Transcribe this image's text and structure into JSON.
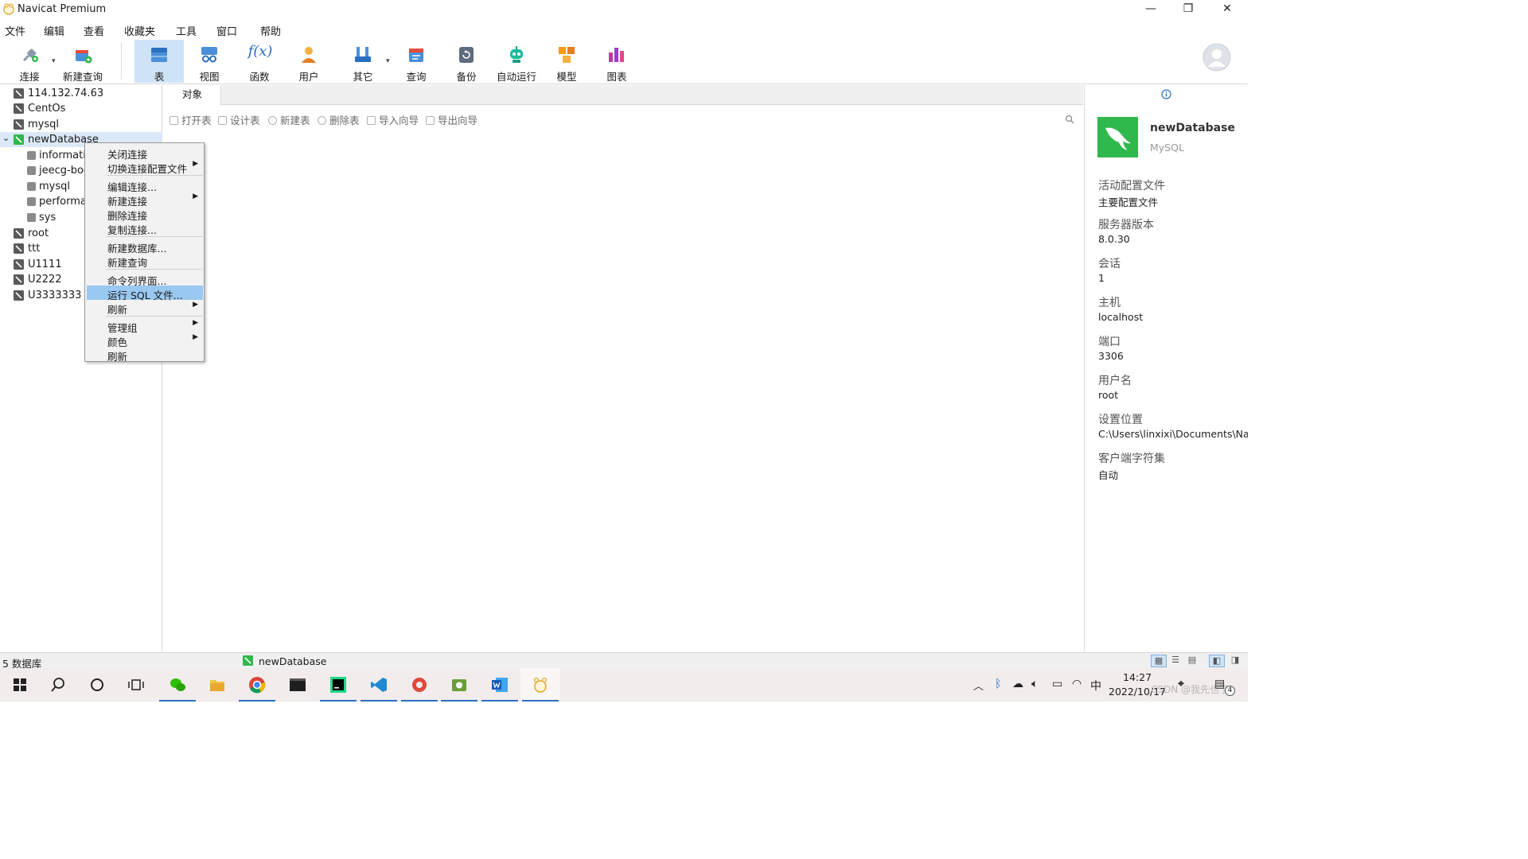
{
  "window": {
    "title": "Navicat Premium",
    "minimize": "—",
    "restore": "❐",
    "close": "✕"
  },
  "menu": [
    "文件",
    "编辑",
    "查看",
    "收藏夹",
    "工具",
    "窗口",
    "帮助"
  ],
  "toolbar": {
    "items": [
      {
        "label": "连接",
        "icon": "plug-icon"
      },
      {
        "label": "新建查询",
        "icon": "new-query-icon"
      },
      {
        "label": "表",
        "icon": "table-icon",
        "active": true
      },
      {
        "label": "视图",
        "icon": "view-icon"
      },
      {
        "label": "函数",
        "icon": "function-icon",
        "glyph": "f(x)"
      },
      {
        "label": "用户",
        "icon": "user-icon"
      },
      {
        "label": "其它",
        "icon": "tools-icon"
      },
      {
        "label": "查询",
        "icon": "query-icon"
      },
      {
        "label": "备份",
        "icon": "backup-icon"
      },
      {
        "label": "自动运行",
        "icon": "robot-icon"
      },
      {
        "label": "模型",
        "icon": "model-icon"
      },
      {
        "label": "图表",
        "icon": "chart-icon"
      }
    ]
  },
  "tree": {
    "connections": [
      {
        "name": "114.132.74.63"
      },
      {
        "name": "CentOs"
      },
      {
        "name": "mysql"
      },
      {
        "name": "newDatabase",
        "expanded": true,
        "selected": true
      },
      {
        "name": "root"
      },
      {
        "name": "ttt"
      },
      {
        "name": "U1111"
      },
      {
        "name": "U2222"
      },
      {
        "name": "U3333333"
      }
    ],
    "databases": [
      "informatio",
      "jeecg-boo",
      "mysql",
      "performa",
      "sys"
    ]
  },
  "context_menu": {
    "groups": [
      [
        {
          "label": "关闭连接"
        },
        {
          "label": "切换连接配置文件",
          "submenu": true
        }
      ],
      [
        {
          "label": "编辑连接..."
        },
        {
          "label": "新建连接",
          "submenu": true
        },
        {
          "label": "删除连接"
        },
        {
          "label": "复制连接..."
        }
      ],
      [
        {
          "label": "新建数据库..."
        },
        {
          "label": "新建查询"
        }
      ],
      [
        {
          "label": "命令列界面..."
        },
        {
          "label": "运行 SQL 文件...",
          "highlighted": true
        },
        {
          "label": "刷新",
          "submenu": true
        }
      ],
      [
        {
          "label": "管理组",
          "submenu": true
        },
        {
          "label": "颜色",
          "submenu": true
        },
        {
          "label": "刷新"
        }
      ]
    ]
  },
  "center": {
    "tab": "对象",
    "object_toolbar": [
      "打开表",
      "设计表",
      "新建表",
      "删除表",
      "导入向导",
      "导出向导"
    ]
  },
  "info_panel": {
    "name": "newDatabase",
    "type": "MySQL",
    "fields": [
      {
        "key": "活动配置文件",
        "value": "主要配置文件"
      },
      {
        "key": "服务器版本",
        "value": "8.0.30"
      },
      {
        "key": "会话",
        "value": "1"
      },
      {
        "key": "主机",
        "value": "localhost"
      },
      {
        "key": "端口",
        "value": "3306"
      },
      {
        "key": "用户名",
        "value": "root"
      },
      {
        "key": "设置位置",
        "value": "C:\\Users\\linxixi\\Documents\\Na"
      },
      {
        "key": "客户端字符集",
        "value": "自动"
      }
    ]
  },
  "statusbar": {
    "left": "5 数据库",
    "connection": "newDatabase"
  },
  "taskbar": {
    "time": "14:27",
    "date": "2022/10/17",
    "ime": "中",
    "notification_count": "4",
    "watermark": "CSDN @我先也了"
  },
  "colors": {
    "accent": "#2b6fc4",
    "selection": "#99c8f0",
    "navicat_green": "#2fb84c"
  }
}
